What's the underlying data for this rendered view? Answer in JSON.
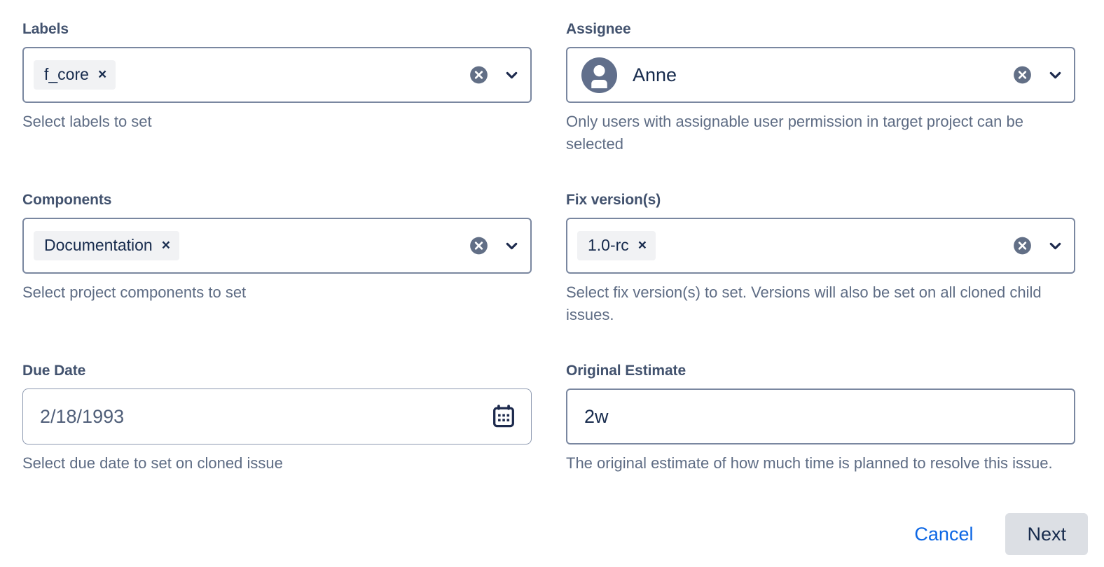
{
  "fields": {
    "labels": {
      "label": "Labels",
      "chips": [
        "f_core"
      ],
      "chip_remove": "×",
      "helper": "Select labels to set",
      "clear_icon": "clear-circle-icon",
      "chevron_icon": "chevron-down-icon"
    },
    "assignee": {
      "label": "Assignee",
      "value": "Anne",
      "avatar_icon": "user-avatar-icon",
      "helper": "Only users with assignable user permission in target project can be selected",
      "clear_icon": "clear-circle-icon",
      "chevron_icon": "chevron-down-icon"
    },
    "components": {
      "label": "Components",
      "chips": [
        "Documentation"
      ],
      "chip_remove": "×",
      "helper": "Select project components to set",
      "clear_icon": "clear-circle-icon",
      "chevron_icon": "chevron-down-icon"
    },
    "fix_versions": {
      "label": "Fix version(s)",
      "chips": [
        "1.0-rc"
      ],
      "chip_remove": "×",
      "helper": "Select fix version(s) to set. Versions will also be set on all cloned child issues.",
      "clear_icon": "clear-circle-icon",
      "chevron_icon": "chevron-down-icon"
    },
    "due_date": {
      "label": "Due Date",
      "value": "2/18/1993",
      "helper": "Select due date to set on cloned issue",
      "calendar_icon": "calendar-icon"
    },
    "original_estimate": {
      "label": "Original Estimate",
      "value": "2w",
      "helper": "The original estimate of how much time is planned to resolve this issue."
    }
  },
  "footer": {
    "cancel_label": "Cancel",
    "next_label": "Next"
  },
  "colors": {
    "link": "#0c66e4",
    "label_text": "#42526e",
    "helper_text": "#5e6c84",
    "value_text": "#172b4d",
    "field_border": "#7a87a0",
    "chip_bg": "#f1f2f4",
    "button_bg": "#dcdfe4",
    "avatar_bg": "#616f8b"
  }
}
